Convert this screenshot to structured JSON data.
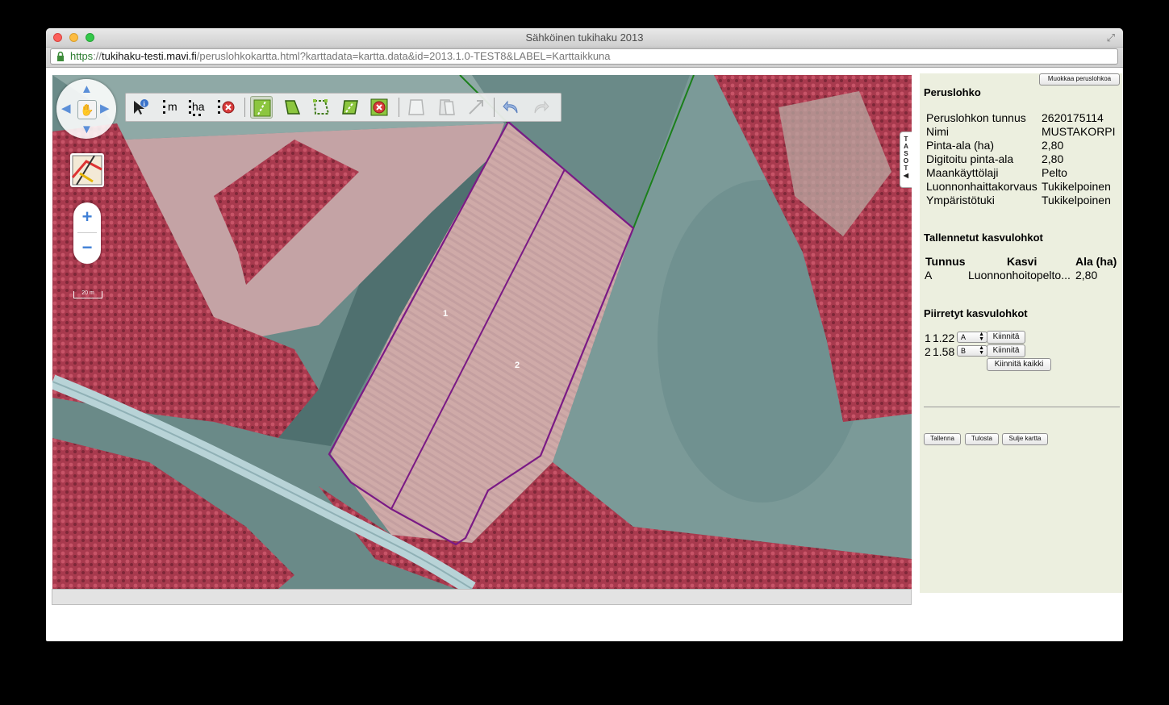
{
  "window": {
    "title": "Sähköinen tukihaku 2013",
    "url_scheme": "https",
    "url_sep": "://",
    "url_host": "tukihaku-testi.mavi.fi",
    "url_path": "/peruslohkokartta.html?karttadata=kartta.data&id=2013.1.0-TEST8&LABEL=Karttaikkuna"
  },
  "map": {
    "scale_label": "20 m",
    "parcel_labels": [
      "1",
      "2"
    ],
    "layers_tab": "T A S O T ◀",
    "toolbar": {
      "info": "feature-info-tool",
      "measure_length": "m",
      "measure_area": "ha"
    }
  },
  "panel": {
    "edit_button": "Muokkaa peruslohkoa",
    "peruslohko_heading": "Peruslohko",
    "attributes": [
      {
        "label": "Peruslohkon tunnus",
        "value": "2620175114"
      },
      {
        "label": "Nimi",
        "value": "MUSTAKORPI"
      },
      {
        "label": "Pinta-ala (ha)",
        "value": "2,80"
      },
      {
        "label": "Digitoitu pinta-ala",
        "value": "2,80"
      },
      {
        "label": "Maankäyttölaji",
        "value": "Pelto"
      },
      {
        "label": "Luonnonhaittakorvaus",
        "value": "Tukikelpoinen"
      },
      {
        "label": "Ympäristötuki",
        "value": "Tukikelpoinen"
      }
    ],
    "saved_heading": "Tallennetut kasvulohkot",
    "saved_columns": [
      "Tunnus",
      "Kasvi",
      "Ala (ha)"
    ],
    "saved_rows": [
      {
        "tunnus": "A",
        "kasvi": "Luonnonhoitopelto...",
        "ala": "2,80"
      }
    ],
    "drawn_heading": "Piirretyt kasvulohkot",
    "drawn_rows": [
      {
        "num": "1",
        "area": "1.22",
        "select": "A",
        "button": "Kiinnitä"
      },
      {
        "num": "2",
        "area": "1.58",
        "select": "B",
        "button": "Kiinnitä"
      }
    ],
    "attach_all": "Kiinnitä kaikki",
    "save_button": "Tallenna",
    "print_button": "Tulosta",
    "close_button": "Sulje kartta"
  },
  "colors": {
    "parcel_outline": "#7a1a85",
    "panel_bg": "#ecefdf",
    "accent_blue": "#3f7fd6"
  }
}
